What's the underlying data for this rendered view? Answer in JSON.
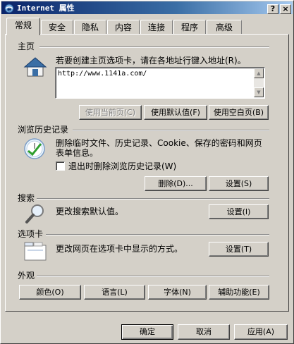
{
  "window": {
    "title": "Internet 属性",
    "help_label": "?",
    "close_label": "×"
  },
  "tabs": [
    "常规",
    "安全",
    "隐私",
    "内容",
    "连接",
    "程序",
    "高级"
  ],
  "homepage": {
    "section": "主页",
    "description": "若要创建主页选项卡，请在各地址行键入地址(R)。",
    "url": "http://www.1141a.com/",
    "btn_current": "使用当前页(C)",
    "btn_default": "使用默认值(F)",
    "btn_blank": "使用空白页(B)"
  },
  "history": {
    "section": "浏览历史记录",
    "description": "删除临时文件、历史记录、Cookie、保存的密码和网页表单信息。",
    "checkbox_label": "退出时删除浏览历史记录(W)",
    "checkbox_checked": false,
    "btn_delete": "删除(D)...",
    "btn_settings": "设置(S)"
  },
  "search": {
    "section": "搜索",
    "description": "更改搜索默认值。",
    "btn_settings": "设置(I)"
  },
  "tabs_section": {
    "section": "选项卡",
    "description": "更改网页在选项卡中显示的方式。",
    "btn_settings": "设置(T)"
  },
  "appearance": {
    "section": "外观",
    "btn_colors": "颜色(O)",
    "btn_languages": "语言(L)",
    "btn_fonts": "字体(N)",
    "btn_accessibility": "辅助功能(E)"
  },
  "footer": {
    "btn_ok": "确定",
    "btn_cancel": "取消",
    "btn_apply": "应用(A)"
  }
}
